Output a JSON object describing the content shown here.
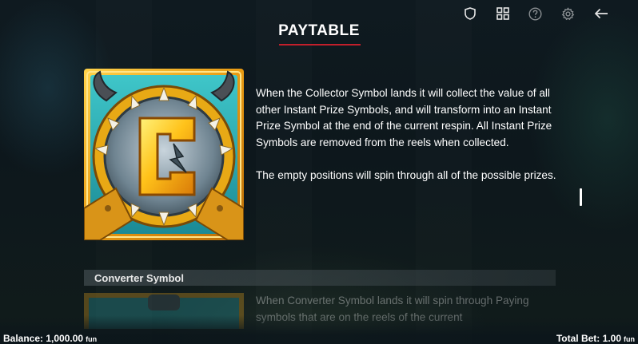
{
  "header": {
    "title": "PAYTABLE",
    "icons": [
      "shield-icon",
      "grid-icon",
      "help-icon",
      "settings-icon",
      "back-arrow-icon"
    ]
  },
  "colors": {
    "accent_underline": "#c21f2b",
    "text": "#ffffff"
  },
  "collector": {
    "symbol_icon": "collector-symbol-icon",
    "paragraph_1": "When the Collector Symbol lands it will collect the value of all other Instant Prize Symbols, and will transform into an Instant Prize Symbol at the end of the current respin. All Instant Prize Symbols are removed from the reels when collected.",
    "paragraph_2": "The empty positions will spin through all of the possible prizes."
  },
  "converter": {
    "section_title": "Converter Symbol",
    "description": "When Converter Symbol lands it will spin through Paying symbols that are on the reels of the current"
  },
  "footer": {
    "balance_label": "Balance:",
    "balance_value": "1,000.00",
    "balance_unit": "fun",
    "total_bet_label": "Total Bet:",
    "total_bet_value": "1.00",
    "total_bet_unit": "fun"
  }
}
